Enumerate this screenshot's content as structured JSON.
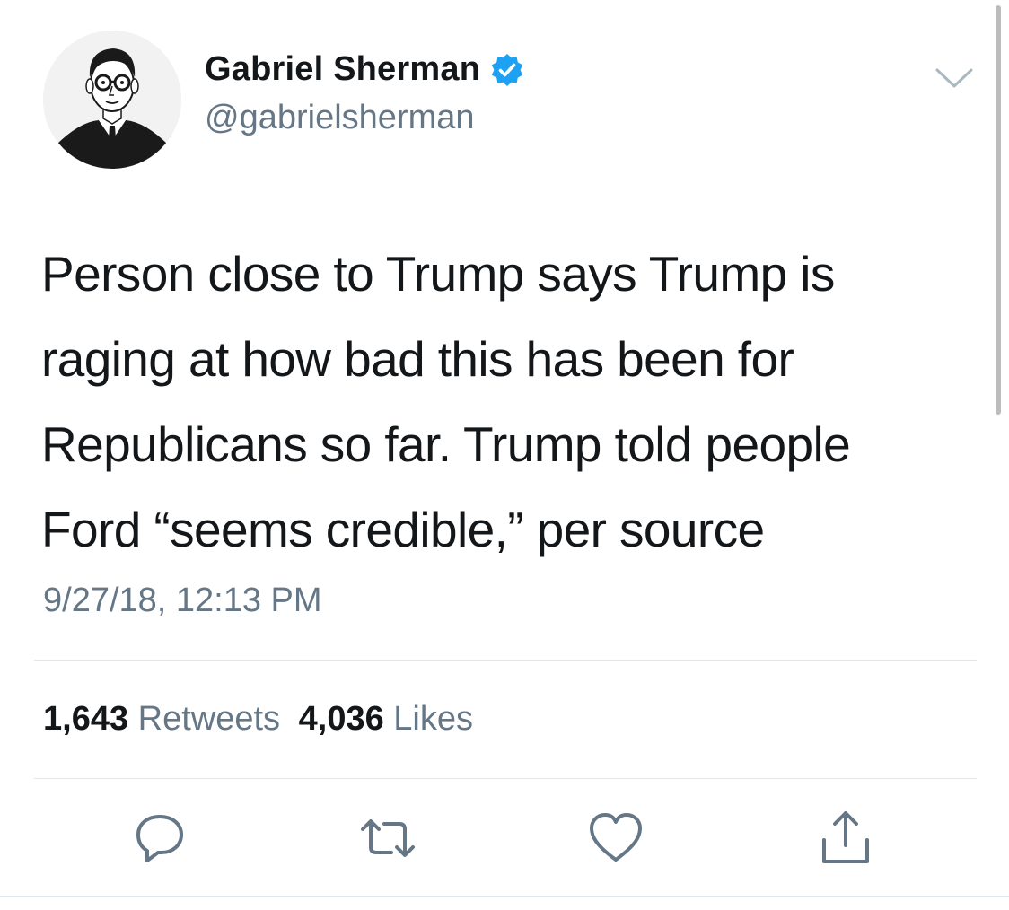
{
  "author": {
    "name": "Gabriel Sherman",
    "handle": "@gabrielsherman",
    "verified_icon": "verified-badge-icon"
  },
  "tweet": {
    "lines": [
      "Person close to Trump says Trump is",
      "raging at how bad this has been for",
      "Republicans so far. Trump told people",
      "Ford “seems credible,” per source"
    ],
    "timestamp": "9/27/18, 12:13 PM"
  },
  "stats": {
    "retweets_count": "1,643",
    "retweets_label": "Retweets",
    "likes_count": "4,036",
    "likes_label": "Likes"
  },
  "actions": [
    "reply-icon",
    "retweet-icon",
    "like-icon",
    "share-icon"
  ],
  "colors": {
    "text": "#14171a",
    "secondary": "#657786",
    "verified": "#1da1f2",
    "divider": "#e1e8ed"
  }
}
